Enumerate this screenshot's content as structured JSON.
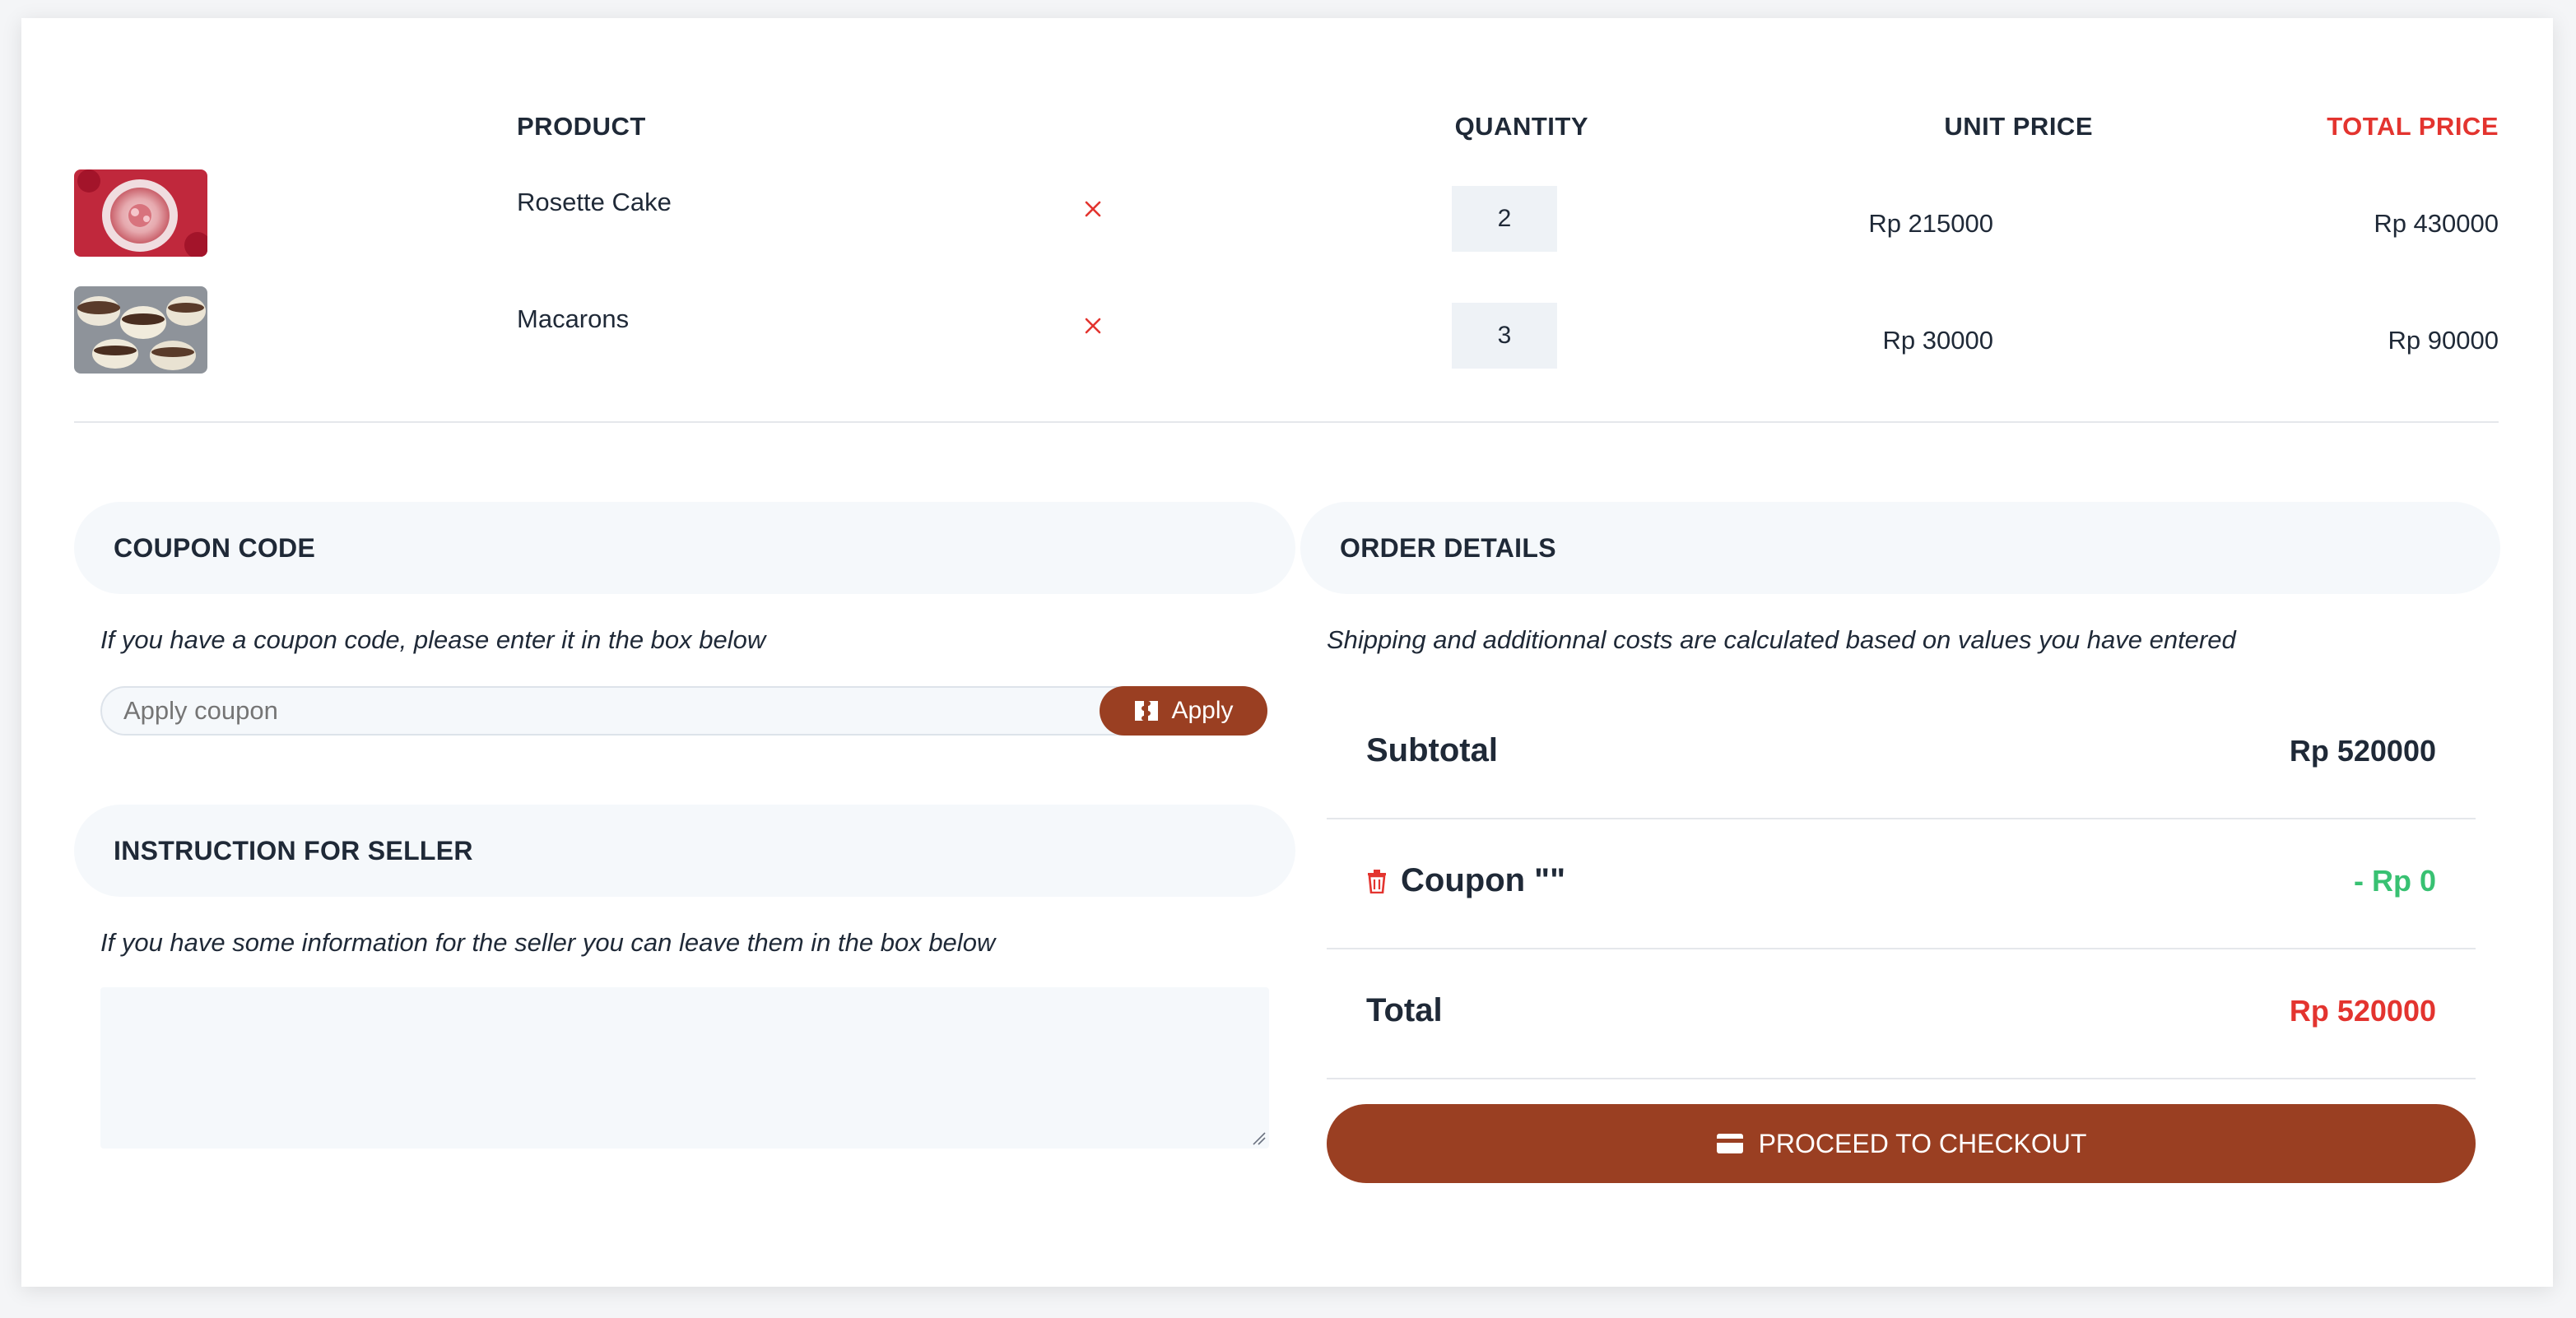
{
  "table": {
    "headers": {
      "product": "PRODUCT",
      "quantity": "QUANTITY",
      "unit_price": "UNIT PRICE",
      "total_price": "TOTAL PRICE"
    },
    "rows": [
      {
        "name": "Rosette Cake",
        "quantity": "2",
        "unit_price": "Rp 215000",
        "total_price": "Rp 430000",
        "image": "rosette-cake-photo"
      },
      {
        "name": "Macarons",
        "quantity": "3",
        "unit_price": "Rp 30000",
        "total_price": "Rp 90000",
        "image": "macarons-photo"
      }
    ]
  },
  "coupon": {
    "title": "COUPON CODE",
    "hint": "If you have a coupon code, please enter it in the box below",
    "placeholder": "Apply coupon",
    "apply_label": "Apply"
  },
  "instructions": {
    "title": "INSTRUCTION FOR SELLER",
    "hint": "If you have some information for the seller you can leave them in the box below"
  },
  "order": {
    "title": "ORDER DETAILS",
    "hint": "Shipping and additionnal costs are calculated based on values you have entered",
    "subtotal_label": "Subtotal",
    "subtotal_value": "Rp 520000",
    "coupon_label": "Coupon \"\"",
    "coupon_value": "- Rp 0",
    "total_label": "Total",
    "total_value": "Rp 520000",
    "checkout_label": "PROCEED TO CHECKOUT"
  },
  "colors": {
    "accent": "#9a3f22",
    "danger": "#e3342f",
    "success": "#38c172"
  }
}
